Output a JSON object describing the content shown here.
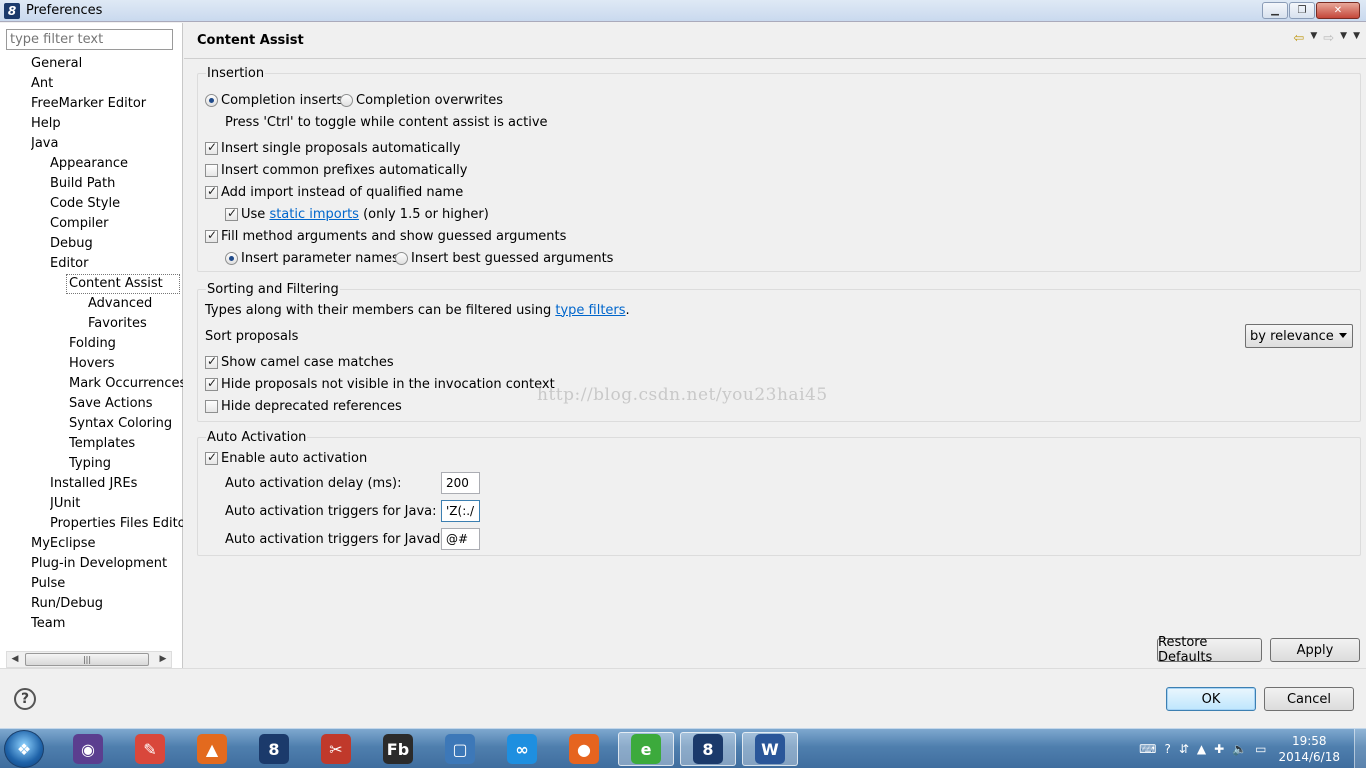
{
  "window": {
    "title": "Preferences"
  },
  "filter": {
    "placeholder": "type filter text"
  },
  "tree": [
    {
      "label": "General",
      "level": 0
    },
    {
      "label": "Ant",
      "level": 0
    },
    {
      "label": "FreeMarker Editor",
      "level": 0
    },
    {
      "label": "Help",
      "level": 0
    },
    {
      "label": "Java",
      "level": 0
    },
    {
      "label": "Appearance",
      "level": 1
    },
    {
      "label": "Build Path",
      "level": 1
    },
    {
      "label": "Code Style",
      "level": 1
    },
    {
      "label": "Compiler",
      "level": 1
    },
    {
      "label": "Debug",
      "level": 1
    },
    {
      "label": "Editor",
      "level": 1
    },
    {
      "label": "Content Assist",
      "level": 2,
      "selected": true
    },
    {
      "label": "Advanced",
      "level": 3
    },
    {
      "label": "Favorites",
      "level": 3
    },
    {
      "label": "Folding",
      "level": 2
    },
    {
      "label": "Hovers",
      "level": 2
    },
    {
      "label": "Mark Occurrences",
      "level": 2
    },
    {
      "label": "Save Actions",
      "level": 2
    },
    {
      "label": "Syntax Coloring",
      "level": 2
    },
    {
      "label": "Templates",
      "level": 2
    },
    {
      "label": "Typing",
      "level": 2
    },
    {
      "label": "Installed JREs",
      "level": 1
    },
    {
      "label": "JUnit",
      "level": 1
    },
    {
      "label": "Properties Files Editor",
      "level": 1
    },
    {
      "label": "MyEclipse",
      "level": 0
    },
    {
      "label": "Plug-in Development",
      "level": 0
    },
    {
      "label": "Pulse",
      "level": 0
    },
    {
      "label": "Run/Debug",
      "level": 0
    },
    {
      "label": "Team",
      "level": 0
    }
  ],
  "page": {
    "title": "Content Assist"
  },
  "insertion": {
    "title": "Insertion",
    "completion_inserts": "Completion inserts",
    "completion_overwrites": "Completion overwrites",
    "toggle_hint": "Press 'Ctrl' to toggle while content assist is active",
    "insert_single": "Insert single proposals automatically",
    "insert_common": "Insert common prefixes automatically",
    "add_import": "Add import instead of qualified name",
    "use": "Use",
    "static_imports": "static imports",
    "only_15": "(only 1.5 or higher)",
    "fill_method": "Fill method arguments and show guessed arguments",
    "insert_param_names": "Insert parameter names",
    "insert_best_guessed": "Insert best guessed arguments"
  },
  "sorting": {
    "title": "Sorting and Filtering",
    "types_text": "Types along with their members can be filtered using",
    "type_filters": "type filters",
    "period": ".",
    "sort_proposals": "Sort proposals",
    "sort_value": "by relevance",
    "camel_case": "Show camel case matches",
    "hide_not_visible": "Hide proposals not visible in the invocation context",
    "hide_deprecated": "Hide deprecated references"
  },
  "auto": {
    "title": "Auto Activation",
    "enable": "Enable auto activation",
    "delay_label": "Auto activation delay (ms):",
    "delay_value": "200",
    "java_label": "Auto activation triggers for Java:",
    "java_value": "'Z(:./?",
    "javadoc_label": "Auto activation triggers for Javadoc:",
    "javadoc_value": "@#"
  },
  "watermark": "http://blog.csdn.net/you23hai45",
  "buttons": {
    "restore_defaults": "Restore Defaults",
    "apply": "Apply",
    "ok": "OK",
    "cancel": "Cancel"
  },
  "taskbar": {
    "time": "19:58",
    "date": "2014/6/18",
    "apps": [
      {
        "icon": "eclipse-icon",
        "color": "#5b3e8f",
        "glyph": "◉"
      },
      {
        "icon": "notepad-icon",
        "color": "#d9473b",
        "glyph": "✎"
      },
      {
        "icon": "matlab-icon",
        "color": "#e36a1e",
        "glyph": "▲"
      },
      {
        "icon": "myeclipse-icon",
        "color": "#1b3a6b",
        "glyph": "8"
      },
      {
        "icon": "snipping-icon",
        "color": "#c0392b",
        "glyph": "✂"
      },
      {
        "icon": "flash-builder-icon",
        "color": "#2b2b2b",
        "glyph": "Fb"
      },
      {
        "icon": "virtualbox-icon",
        "color": "#3d78b8",
        "glyph": "▢"
      },
      {
        "icon": "network-app-icon",
        "color": "#1e8fe0",
        "glyph": "∞"
      },
      {
        "icon": "firefox-icon",
        "color": "#e6641f",
        "glyph": "●"
      },
      {
        "icon": "browser-icon",
        "color": "#3caa3c",
        "glyph": "e"
      },
      {
        "icon": "myeclipse-active-icon",
        "color": "#1b3a6b",
        "glyph": "8"
      },
      {
        "icon": "word-icon",
        "color": "#2a5699",
        "glyph": "W"
      }
    ]
  }
}
